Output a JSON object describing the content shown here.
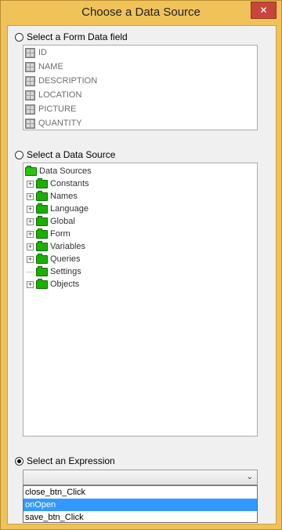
{
  "window": {
    "title": "Choose a Data Source",
    "close_label": "✕"
  },
  "form_data": {
    "label": "Select a Form Data field",
    "fields": [
      "ID",
      "NAME",
      "DESCRIPTION",
      "LOCATION",
      "PICTURE",
      "QUANTITY"
    ]
  },
  "data_source": {
    "label": "Select a Data Source",
    "root": "Data Sources",
    "items": [
      {
        "label": "Constants",
        "expander": "+"
      },
      {
        "label": "Names",
        "expander": "+"
      },
      {
        "label": "Language",
        "expander": "+"
      },
      {
        "label": "Global",
        "expander": "+"
      },
      {
        "label": "Form",
        "expander": "+"
      },
      {
        "label": "Variables",
        "expander": "+"
      },
      {
        "label": "Queries",
        "expander": "+"
      },
      {
        "label": "Settings",
        "expander": ""
      },
      {
        "label": "Objects",
        "expander": "+"
      }
    ]
  },
  "expression": {
    "label": "Select an Expression",
    "selected": "",
    "arrow": "⌄",
    "options": [
      "close_btn_Click",
      "onOpen",
      "save_btn_Click"
    ],
    "highlighted": "onOpen"
  },
  "colors": {
    "frame": "#f0c25a",
    "close": "#c7463b",
    "folder": "#19b000",
    "highlight": "#3399ff"
  }
}
